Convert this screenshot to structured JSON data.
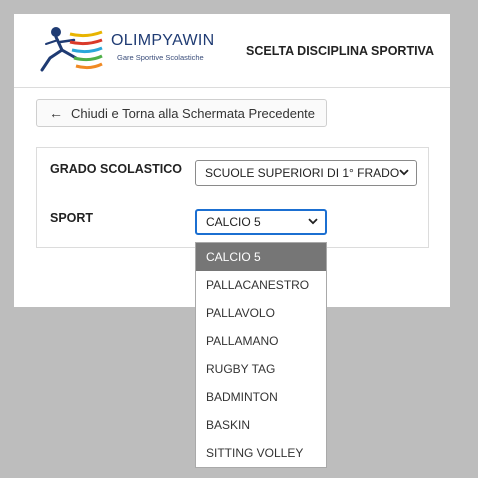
{
  "header": {
    "brand_name": "OLIMPYAWIN",
    "brand_subtitle": "Gare Sportive Scolastiche",
    "page_title": "SCELTA DISCIPLINA SPORTIVA"
  },
  "back_button": {
    "label": "Chiudi e Torna alla Schermata Precedente",
    "icon": "arrow-left-icon"
  },
  "form": {
    "grado_label": "GRADO SCOLASTICO",
    "grado_value": "SCUOLE SUPERIORI DI 1° FRADO",
    "sport_label": "SPORT",
    "sport_value": "CALCIO 5"
  },
  "dropdown": {
    "options": [
      "CALCIO 5",
      "PALLACANESTRO",
      "PALLAVOLO",
      "PALLAMANO",
      "RUGBY TAG",
      "BADMINTON",
      "BASKIN",
      "SITTING VOLLEY"
    ],
    "selected_index": 0
  },
  "colors": {
    "accent": "#1b6fd1",
    "brand": "#1f3b73",
    "selected_bg": "#767676",
    "backdrop": "#bdbdbd"
  }
}
